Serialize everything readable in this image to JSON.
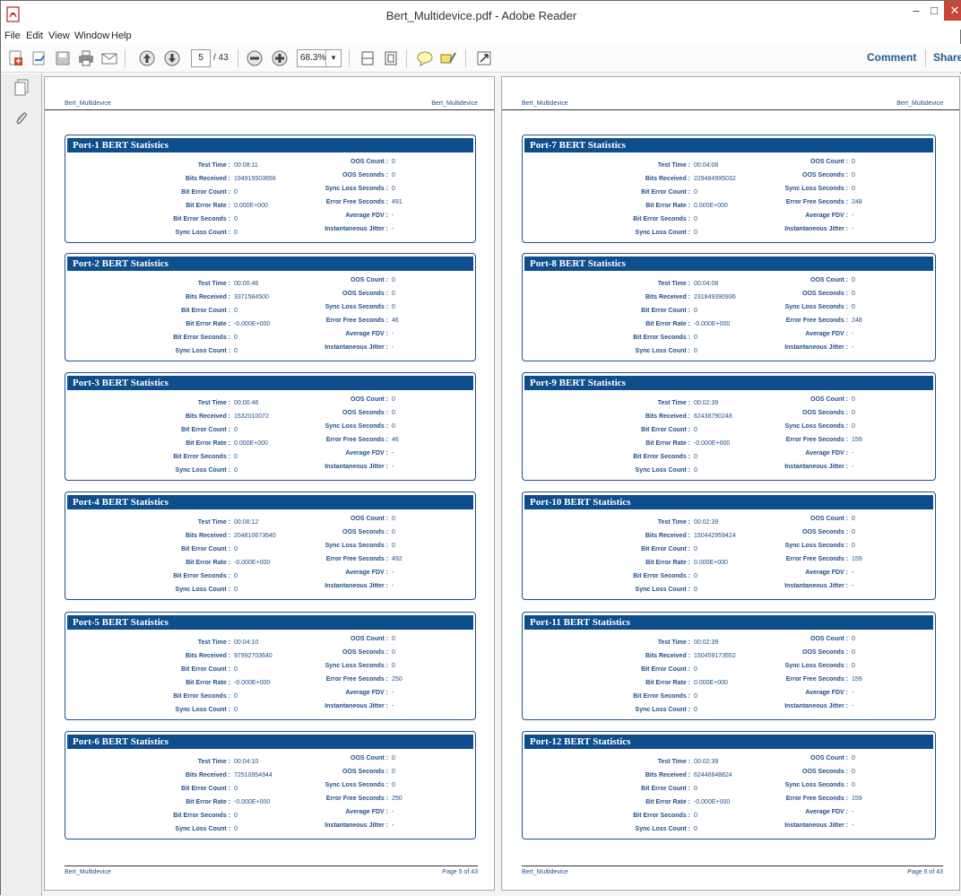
{
  "window": {
    "title": "Bert_Multidevice.pdf - Adobe Reader",
    "min": "–",
    "max": "□",
    "close": "✕"
  },
  "menu": [
    "File",
    "Edit",
    "View",
    "Window",
    "Help"
  ],
  "toolbar": {
    "page_current": "5",
    "page_total": "/ 43",
    "zoom": "68.3%",
    "comment": "Comment",
    "share": "Share"
  },
  "doc": {
    "header_left": "Bert_Multidevice",
    "header_right": "Bert_Multidevice",
    "footer_left": "Bert_Multidevice",
    "footer_right_left": "Page 5 of 43",
    "footer_right_right": "Page 6 of 43"
  },
  "labels": {
    "test_time": "Test Time :",
    "bits_received": "Bits Received :",
    "bit_error_count": "Bit Error Count :",
    "bit_error_rate": "Bit Error Rate :",
    "bit_error_seconds": "Bit Error Seconds :",
    "sync_loss_count": "Sync Loss Count :",
    "oos_count": "OOS Count :",
    "oos_seconds": "OOS Seconds :",
    "sync_loss_seconds": "Sync Loss Seconds :",
    "error_free_seconds": "Error Free Seconds :",
    "average_fdv": "Average FDV :",
    "instantaneous_jitter": "Instantaneous Jitter :"
  },
  "ports": [
    {
      "title": "Port-1 BERT Statistics",
      "test_time": "00:08:11",
      "bits_received": "194915503656",
      "bit_error_count": "0",
      "bit_error_rate": "0.000E+000",
      "bit_error_seconds": "0",
      "sync_loss_count": "0",
      "oos_count": "0",
      "oos_seconds": "0",
      "sync_loss_seconds": "0",
      "error_free_seconds": "491",
      "average_fdv": "-",
      "instantaneous_jitter": "-"
    },
    {
      "title": "Port-2 BERT Statistics",
      "test_time": "00:00:46",
      "bits_received": "3371584500",
      "bit_error_count": "0",
      "bit_error_rate": "-0.000E+000",
      "bit_error_seconds": "0",
      "sync_loss_count": "0",
      "oos_count": "0",
      "oos_seconds": "0",
      "sync_loss_seconds": "0",
      "error_free_seconds": "46",
      "average_fdv": "-",
      "instantaneous_jitter": "-"
    },
    {
      "title": "Port-3 BERT Statistics",
      "test_time": "00:00:46",
      "bits_received": "1532010072",
      "bit_error_count": "0",
      "bit_error_rate": "0.000E+000",
      "bit_error_seconds": "0",
      "sync_loss_count": "0",
      "oos_count": "0",
      "oos_seconds": "0",
      "sync_loss_seconds": "0",
      "error_free_seconds": "46",
      "average_fdv": "-",
      "instantaneous_jitter": "-"
    },
    {
      "title": "Port-4 BERT Statistics",
      "test_time": "00:08:12",
      "bits_received": "204810673640",
      "bit_error_count": "0",
      "bit_error_rate": "-0.000E+000",
      "bit_error_seconds": "0",
      "sync_loss_count": "0",
      "oos_count": "0",
      "oos_seconds": "0",
      "sync_loss_seconds": "0",
      "error_free_seconds": "492",
      "average_fdv": "-",
      "instantaneous_jitter": "-"
    },
    {
      "title": "Port-5 BERT Statistics",
      "test_time": "00:04:10",
      "bits_received": "97992703640",
      "bit_error_count": "0",
      "bit_error_rate": "-0.000E+000",
      "bit_error_seconds": "0",
      "sync_loss_count": "0",
      "oos_count": "0",
      "oos_seconds": "0",
      "sync_loss_seconds": "0",
      "error_free_seconds": "250",
      "average_fdv": "-",
      "instantaneous_jitter": "-"
    },
    {
      "title": "Port-6 BERT Statistics",
      "test_time": "00:04:10",
      "bits_received": "72510954944",
      "bit_error_count": "0",
      "bit_error_rate": "-0.000E+000",
      "bit_error_seconds": "0",
      "sync_loss_count": "0",
      "oos_count": "0",
      "oos_seconds": "0",
      "sync_loss_seconds": "0",
      "error_free_seconds": "250",
      "average_fdv": "-",
      "instantaneous_jitter": "-"
    },
    {
      "title": "Port-7 BERT Statistics",
      "test_time": "00:04:08",
      "bits_received": "229484995032",
      "bit_error_count": "0",
      "bit_error_rate": "0.000E+000",
      "bit_error_seconds": "0",
      "sync_loss_count": "0",
      "oos_count": "0",
      "oos_seconds": "0",
      "sync_loss_seconds": "0",
      "error_free_seconds": "248",
      "average_fdv": "-",
      "instantaneous_jitter": "-"
    },
    {
      "title": "Port-8 BERT Statistics",
      "test_time": "00:04:08",
      "bits_received": "231849390936",
      "bit_error_count": "0",
      "bit_error_rate": "-0.000E+000",
      "bit_error_seconds": "0",
      "sync_loss_count": "0",
      "oos_count": "0",
      "oos_seconds": "0",
      "sync_loss_seconds": "0",
      "error_free_seconds": "248",
      "average_fdv": "-",
      "instantaneous_jitter": "-"
    },
    {
      "title": "Port-9 BERT Statistics",
      "test_time": "00:02:39",
      "bits_received": "62438790248",
      "bit_error_count": "0",
      "bit_error_rate": "-0.000E+000",
      "bit_error_seconds": "0",
      "sync_loss_count": "0",
      "oos_count": "0",
      "oos_seconds": "0",
      "sync_loss_seconds": "0",
      "error_free_seconds": "159",
      "average_fdv": "-",
      "instantaneous_jitter": "-"
    },
    {
      "title": "Port-10 BERT Statistics",
      "test_time": "00:02:39",
      "bits_received": "150442959424",
      "bit_error_count": "0",
      "bit_error_rate": "0.000E+000",
      "bit_error_seconds": "0",
      "sync_loss_count": "0",
      "oos_count": "0",
      "oos_seconds": "0",
      "sync_loss_seconds": "0",
      "error_free_seconds": "159",
      "average_fdv": "-",
      "instantaneous_jitter": "-"
    },
    {
      "title": "Port-11 BERT Statistics",
      "test_time": "00:02:39",
      "bits_received": "150459173552",
      "bit_error_count": "0",
      "bit_error_rate": "0.000E+000",
      "bit_error_seconds": "0",
      "sync_loss_count": "0",
      "oos_count": "0",
      "oos_seconds": "0",
      "sync_loss_seconds": "0",
      "error_free_seconds": "159",
      "average_fdv": "-",
      "instantaneous_jitter": "-"
    },
    {
      "title": "Port-12 BERT Statistics",
      "test_time": "00:02:39",
      "bits_received": "62446648824",
      "bit_error_count": "0",
      "bit_error_rate": "-0.000E+000",
      "bit_error_seconds": "0",
      "sync_loss_count": "0",
      "oos_count": "0",
      "oos_seconds": "0",
      "sync_loss_seconds": "0",
      "error_free_seconds": "159",
      "average_fdv": "-",
      "instantaneous_jitter": "-"
    }
  ]
}
